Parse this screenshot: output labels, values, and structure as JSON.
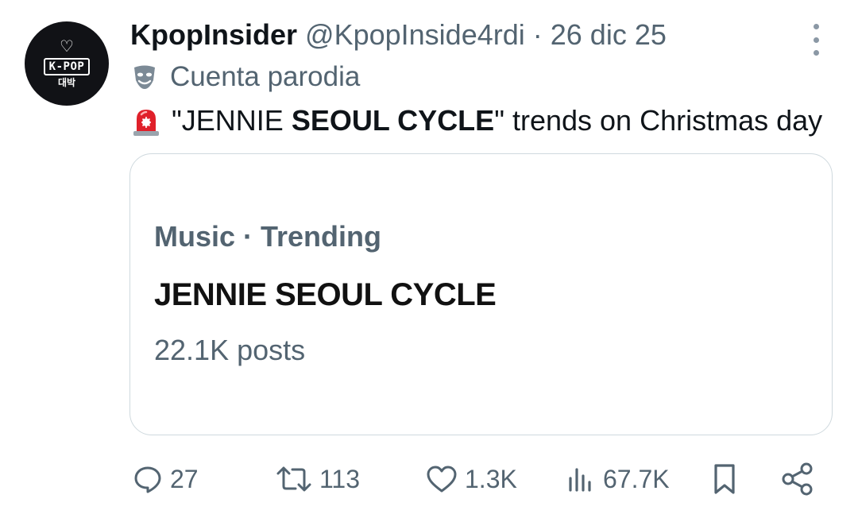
{
  "avatar": {
    "kpop": "K-POP",
    "sub": "대박",
    "icon": "heart-icon"
  },
  "header": {
    "name": "KpopInsider",
    "handle": "@KpopInside4rdi",
    "separator": " · ",
    "date": "26 dic 25"
  },
  "parody": {
    "icon": "theater-mask-icon",
    "label": "Cuenta parodia"
  },
  "tweet": {
    "icon": "siren-icon",
    "prefix": "\"JENNIE ",
    "bold": "SEOUL CYCLE",
    "suffix": "\" trends on Christmas day"
  },
  "card": {
    "meta": "Music · Trending",
    "title": "JENNIE SEOUL CYCLE",
    "posts": "22.1K posts"
  },
  "actions": {
    "replies": "27",
    "retweets": "113",
    "likes": "1.3K",
    "views": "67.7K"
  },
  "colors": {
    "text": "#0f1419",
    "secondary": "#536471",
    "border": "#cfd9de",
    "avatar_bg": "#111216",
    "siren_red": "#e0202a"
  }
}
